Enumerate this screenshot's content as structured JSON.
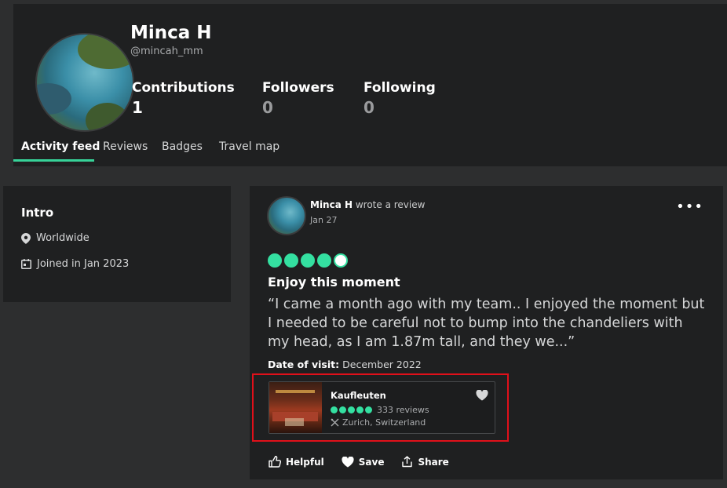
{
  "profile": {
    "name": "Minca H",
    "handle": "@mincah_mm",
    "stats": [
      {
        "label": "Contributions",
        "value": "1"
      },
      {
        "label": "Followers",
        "value": "0"
      },
      {
        "label": "Following",
        "value": "0"
      }
    ],
    "tabs": [
      "Activity feed",
      "Reviews",
      "Badges",
      "Travel map"
    ],
    "active_tab": "Activity feed"
  },
  "intro": {
    "title": "Intro",
    "location": "Worldwide",
    "joined": "Joined in Jan 2023"
  },
  "post": {
    "author": "Minca H",
    "action": "wrote a review",
    "date": "Jan 27",
    "rating": 4.5,
    "title": "Enjoy this moment",
    "body": "“I came a month ago with my team.. I enjoyed the moment but I needed to be careful not to bump into the chandeliers with my head, as I am 1.87m tall, and they we...”",
    "visit_label": "Date of visit:",
    "visit_date": "December 2022",
    "place": {
      "name": "Kaufleuten",
      "rating": 5,
      "reviews": "333 reviews",
      "location": "Zurich, Switzerland"
    },
    "actions": {
      "helpful": "Helpful",
      "save": "Save",
      "share": "Share"
    }
  },
  "colors": {
    "accent": "#34e0a1",
    "panel": "#1f2021",
    "background": "#2d2e2f",
    "highlight": "#e0101a"
  }
}
